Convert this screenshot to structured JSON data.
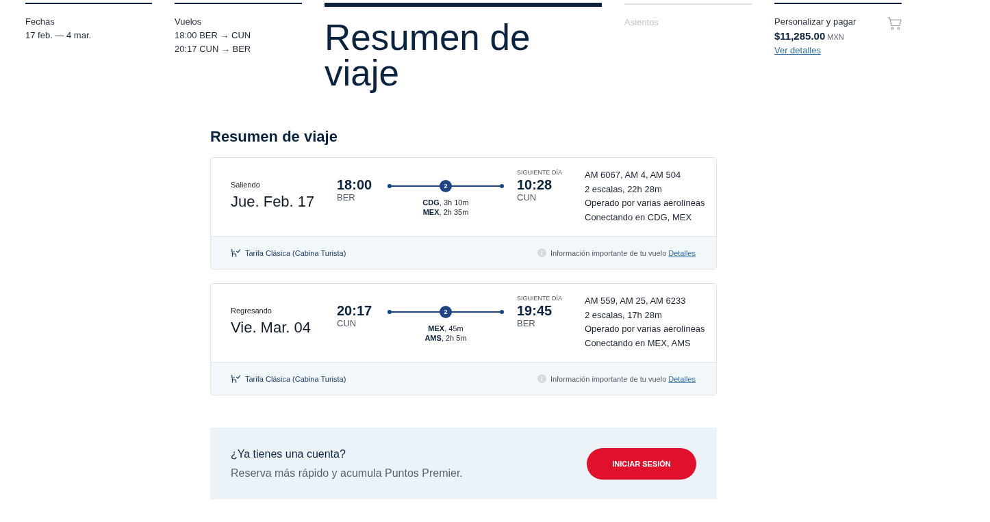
{
  "steps": [
    {
      "kind": "summary",
      "label": "Fechas",
      "lines": [
        "17 feb. — 4 mar."
      ],
      "selected": false,
      "disabled": false
    },
    {
      "kind": "summary",
      "label": "Vuelos",
      "lines": [
        "18:00 BER → CUN",
        "20:17 CUN → BER"
      ],
      "selected": false,
      "disabled": false
    },
    {
      "kind": "summary",
      "label": "Resumen de viaje",
      "selected": true,
      "disabled": false
    },
    {
      "kind": "summary",
      "label": "Asientos",
      "selected": false,
      "disabled": true
    },
    {
      "kind": "cart",
      "label": "Personalizar y pagar",
      "price": "$11,285.00",
      "currency": "MXN",
      "link": "Ver detalles",
      "selected": false,
      "disabled": false
    }
  ],
  "section_title": "Resumen de viaje",
  "flights": [
    {
      "direction": "Saliendo",
      "date": "Jue. Feb. 17",
      "depart_time": "18:00",
      "depart_code": "BER",
      "stops_count": "2",
      "stops": [
        "**CDG**, 3h 10m",
        "**MEX**, 2h 35m"
      ],
      "arrival_note": "SIGUIENTE DÍA",
      "arrive_time": "10:28",
      "arrive_code": "CUN",
      "details": [
        "AM 6067, AM 4, AM 504",
        "2 escalas, 22h 28m",
        "Operado por varias aerolíneas",
        "Conectando en CDG, MEX"
      ],
      "fare": "Tarifa Clásica (Cabina Turista)",
      "info": "Información importante de tu vuelo",
      "info_link": "Detalles"
    },
    {
      "direction": "Regresando",
      "date": "Vie. Mar. 04",
      "depart_time": "20:17",
      "depart_code": "CUN",
      "stops_count": "2",
      "stops": [
        "**MEX**, 45m",
        "**AMS**, 2h 5m"
      ],
      "arrival_note": "SIGUIENTE DÍA",
      "arrive_time": "19:45",
      "arrive_code": "BER",
      "details": [
        "AM 559, AM 25, AM 6233",
        "2 escalas, 17h 28m",
        "Operado por varias aerolíneas",
        "Conectando en MEX, AMS"
      ],
      "fare": "Tarifa Clásica (Cabina Turista)",
      "info": "Información importante de tu vuelo",
      "info_link": "Detalles"
    }
  ],
  "login_banner": {
    "title": "¿Ya tienes una cuenta?",
    "text": "Reserva más rápido y acumula Puntos Premier.",
    "button": "INICIAR SESIÓN"
  }
}
